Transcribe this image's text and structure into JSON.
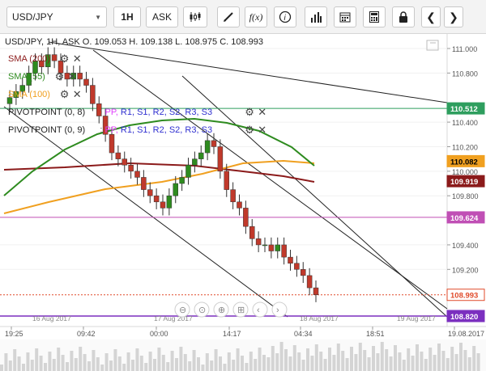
{
  "toolbar": {
    "symbol": "USD/JPY",
    "timeframe": "1H",
    "price_type": "ASK",
    "chart_type_icon": "candlestick-icon",
    "draw_icon": "pencil-icon",
    "indicator_icon": "fx-icon",
    "info_icon": "info-icon",
    "volume_icon": "bar-chart-icon",
    "calendar_icon": "calendar-icon",
    "calculator_icon": "calculator-icon",
    "lock_icon": "lock-icon",
    "prev_icon": "chevron-left-icon",
    "next_icon": "chevron-right-icon"
  },
  "header": {
    "title": "USD/JPY, 1H, ASK",
    "ohlc": "O. 109.053 H. 109.138 L. 108.975 C. 108.993"
  },
  "indicators": [
    {
      "label": "SMA (200)",
      "color": "#8b1a1a"
    },
    {
      "label": "SMA (55)",
      "color": "#2e8b1f"
    },
    {
      "label": "SMA (100)",
      "color": "#f0a020"
    },
    {
      "label": "PIVOTPOINT (0, 8)",
      "suffix": ": PP, R1, S1, R2, S2, R3, S3"
    },
    {
      "label": "PIVOTPOINT (0, 9)",
      "suffix": ": PP, R1, S1, R2, S2, R3, S3"
    }
  ],
  "price_axis": {
    "ticks": [
      "111.000",
      "110.800",
      "110.400",
      "110.200",
      "110.000",
      "109.800",
      "109.400",
      "109.200"
    ],
    "tags": [
      {
        "value": "110.512",
        "color": "#2e9e5e",
        "text_color": "#ffffff"
      },
      {
        "value": "110.082",
        "color": "#f0a020",
        "text_color": "#000000"
      },
      {
        "value": "109.919",
        "color": "#8b1a1a",
        "text_color": "#ffffff"
      },
      {
        "value": "109.624",
        "color": "#c04fb5",
        "text_color": "#ffffff"
      },
      {
        "value": "108.993",
        "color": "#ffffff",
        "text_color": "#e04a2a"
      },
      {
        "value": "108.820",
        "color": "#7b2fbf",
        "text_color": "#ffffff"
      }
    ]
  },
  "time_axis": {
    "ticks": [
      "19:25",
      "09:42",
      "00:00",
      "14:17",
      "04:34",
      "18:51",
      "19.08.2017"
    ],
    "date_markers": [
      "16 Aug 2017",
      "17 Aug 2017",
      "18 Aug 2017",
      "19 Aug 2017"
    ]
  },
  "colors": {
    "bull": "#2e8b1f",
    "bear": "#c0392b",
    "pivot_pp": "#e040fb",
    "pivot_r": "#3030d0"
  },
  "chart_data": {
    "type": "candlestick",
    "symbol": "USD/JPY",
    "timeframe": "1H",
    "last_close": 108.993,
    "ohlc_last": {
      "open": 109.053,
      "high": 109.138,
      "low": 108.975,
      "close": 108.993
    },
    "candles_close": [
      110.6,
      110.65,
      110.7,
      110.8,
      110.9,
      110.85,
      110.95,
      110.9,
      110.8,
      110.75,
      110.8,
      110.75,
      110.7,
      110.55,
      110.45,
      110.3,
      110.15,
      110.1,
      110.05,
      110.0,
      109.95,
      109.85,
      109.8,
      109.75,
      109.7,
      109.8,
      109.9,
      109.95,
      110.05,
      110.1,
      110.15,
      110.25,
      110.2,
      110.0,
      109.85,
      109.75,
      109.7,
      109.55,
      109.45,
      109.4,
      109.4,
      109.35,
      109.4,
      109.3,
      109.25,
      109.2,
      109.15,
      109.05,
      108.993
    ],
    "levels": [
      {
        "name": "green horizontal",
        "value": 110.512
      },
      {
        "name": "orange SMA 100",
        "value": 110.082
      },
      {
        "name": "dark red SMA 200",
        "value": 109.919
      },
      {
        "name": "magenta pivot",
        "value": 109.624
      },
      {
        "name": "purple pivot",
        "value": 108.82
      }
    ]
  }
}
